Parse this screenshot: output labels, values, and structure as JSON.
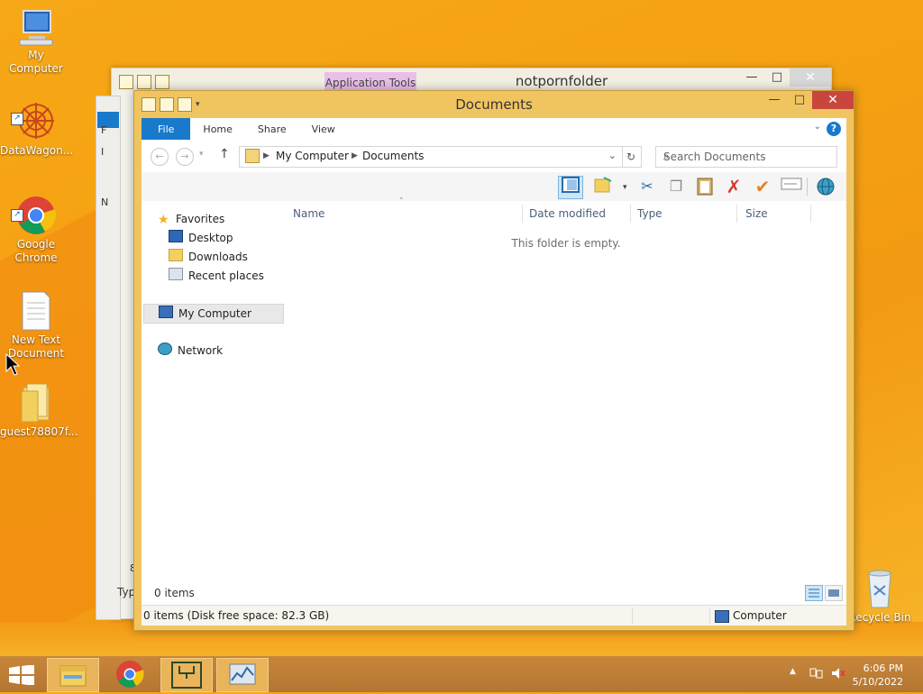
{
  "desktop": {
    "icons": [
      {
        "label": "My Computer"
      },
      {
        "label": "DataWagon..."
      },
      {
        "label": "Google Chrome"
      },
      {
        "label": "New Text Document"
      },
      {
        "label": "guest78807f..."
      },
      {
        "label": "Recycle Bin"
      }
    ]
  },
  "back_window": {
    "title": "notpornfolder",
    "context_tab": "Application Tools",
    "left_fragments": [
      "F",
      "I",
      "N",
      "8",
      "Typ"
    ]
  },
  "window": {
    "title": "Documents",
    "ribbon_tabs": [
      "File",
      "Home",
      "Share",
      "View"
    ],
    "help_label": "?",
    "address": {
      "root": "My Computer",
      "folder": "Documents"
    },
    "search_placeholder": "Search Documents",
    "nav_pane": {
      "favorites": "Favorites",
      "favorite_items": [
        "Desktop",
        "Downloads",
        "Recent places"
      ],
      "computer": "My Computer",
      "network": "Network"
    },
    "columns": [
      "Name",
      "Date modified",
      "Type",
      "Size"
    ],
    "empty_message": "This folder is empty.",
    "item_count": "0 items",
    "details_status": "0 items (Disk free space: 82.3 GB)",
    "details_location": "Computer"
  },
  "taskbar": {
    "time": "6:06 PM",
    "date": "5/10/2022"
  },
  "colors": {
    "desktop": "#f4a013",
    "window_frame": "#f0c560",
    "file_tab": "#1979ca",
    "close_button": "#c9463d",
    "taskbar": "#b37631"
  }
}
